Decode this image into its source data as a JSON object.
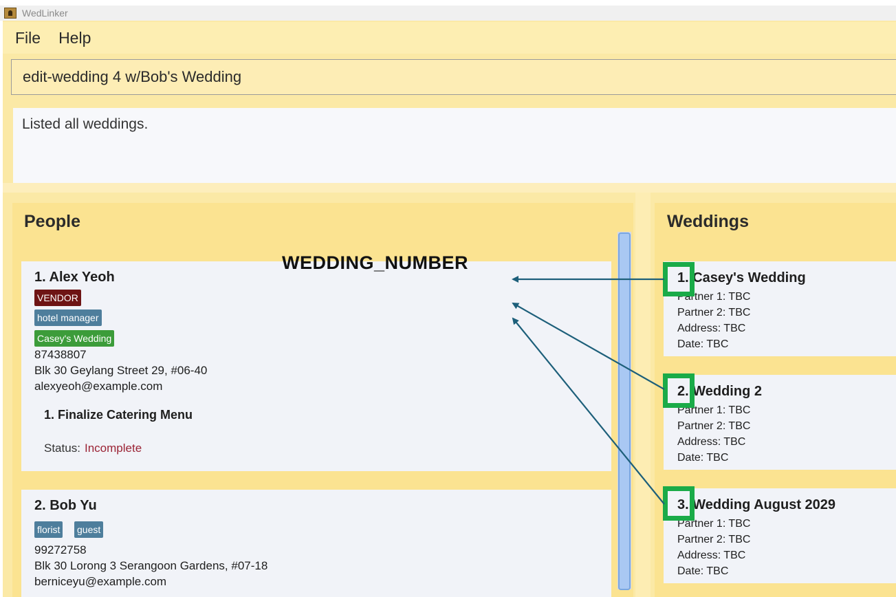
{
  "app": {
    "title": "WedLinker"
  },
  "menu": {
    "file": "File",
    "help": "Help"
  },
  "command": {
    "value": "edit-wedding 4 w/Bob's Wedding"
  },
  "result": {
    "text": "Listed all weddings."
  },
  "people": {
    "title": "People",
    "persons": [
      {
        "name": "1. Alex Yeoh",
        "role_tag": "VENDOR",
        "tags": [
          "hotel manager"
        ],
        "wedding_tags": [
          "Casey's Wedding"
        ],
        "phone": "87438807",
        "address": "Blk 30 Geylang Street 29, #06-40",
        "email": "alexyeoh@example.com",
        "task": {
          "title": "1. Finalize Catering Menu",
          "status_label": "Status:",
          "status_value": "Incomplete"
        }
      },
      {
        "name": "2. Bob Yu",
        "tags": [
          "florist",
          "guest"
        ],
        "phone": "99272758",
        "address": "Blk 30 Lorong 3 Serangoon Gardens, #07-18",
        "email": "berniceyu@example.com"
      }
    ]
  },
  "weddings": {
    "title": "Weddings",
    "items": [
      {
        "name": "1. Casey's Wedding",
        "partner1": "Partner 1: TBC",
        "partner2": "Partner 2: TBC",
        "address": "Address: TBC",
        "date": "Date: TBC"
      },
      {
        "name": "2. Wedding 2",
        "partner1": "Partner 1: TBC",
        "partner2": "Partner 2: TBC",
        "address": "Address: TBC",
        "date": "Date: TBC"
      },
      {
        "name": "3. Wedding August 2029",
        "partner1": "Partner 1: TBC",
        "partner2": "Partner 2: TBC",
        "address": "Address: TBC",
        "date": "Date: TBC"
      }
    ]
  },
  "annotation": {
    "label": "WEDDING_NUMBER",
    "arrow_color": "#1d5f7a",
    "highlight_color": "#1aab48"
  },
  "colors": {
    "window_bg": "#fbe9a6",
    "card_bg": "#f1f3f8",
    "tag_vendor": "#6e1414",
    "tag_plain": "#4e7e9c",
    "tag_wedding": "#3c9c3a",
    "status_incomplete": "#9b2335"
  }
}
